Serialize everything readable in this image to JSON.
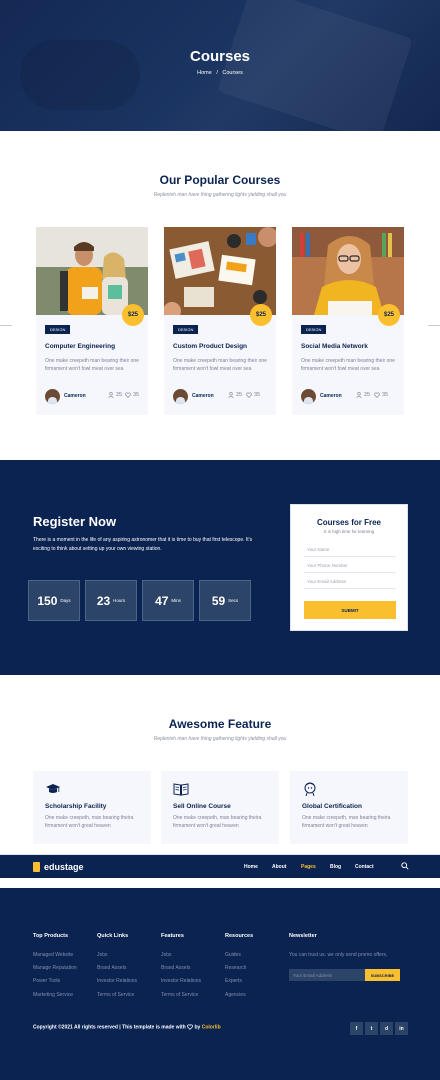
{
  "hero": {
    "title": "Courses",
    "breadcrumb_home": "Home",
    "breadcrumb_sep": "/",
    "breadcrumb_current": "Courses"
  },
  "popular": {
    "title": "Our Popular Courses",
    "subtitle": "Replenish man have thing gathering lights yielding shall you"
  },
  "courses": [
    {
      "price": "$25",
      "tag": "DESIGN",
      "title": "Computer Engineering",
      "description": "One make creepeth man bearing their one firmament won't fowl meat over sea",
      "author": "Cameron",
      "students": "25",
      "likes": "35"
    },
    {
      "price": "$25",
      "tag": "DESIGN",
      "title": "Custom Product Design",
      "description": "One make creepeth man bearing their one firmament won't fowl meat over sea",
      "author": "Cameron",
      "students": "25",
      "likes": "35"
    },
    {
      "price": "$25",
      "tag": "DESIGN",
      "title": "Social Media Network",
      "description": "One make creepeth man bearing their one firmament won't fowl meat over sea",
      "author": "Cameron",
      "students": "25",
      "likes": "35"
    }
  ],
  "register": {
    "title": "Register Now",
    "description": "There is a moment in the life of any aspiring astronomer that it is time to buy that first telescope. It's exciting to think about setting up your own viewing station.",
    "countdown": [
      {
        "value": "150",
        "unit": "Days"
      },
      {
        "value": "23",
        "unit": "Hours"
      },
      {
        "value": "47",
        "unit": "Mins"
      },
      {
        "value": "59",
        "unit": "Secs"
      }
    ],
    "form": {
      "title": "Courses for Free",
      "subtitle": "It is high time for learning",
      "name_placeholder": "Your Name",
      "phone_placeholder": "Your Phone Number",
      "email_placeholder": "Your Email Address",
      "submit": "SUBMIT"
    }
  },
  "features": {
    "title": "Awesome Feature",
    "subtitle": "Replenish man have thing gathering lights yielding shall you",
    "items": [
      {
        "icon": "graduation-cap-icon",
        "title": "Scholarship Facility",
        "description": "One make creepeth, man bearing theira firmament won't great heaven"
      },
      {
        "icon": "open-book-icon",
        "title": "Sell Online Course",
        "description": "One make creepeth, man bearing theira firmament won't great heaven"
      },
      {
        "icon": "certificate-icon",
        "title": "Global Certification",
        "description": "One make creepeth, man bearing theira firmament won't great heaven"
      }
    ]
  },
  "navbar": {
    "logo": "edustage",
    "items": [
      "Home",
      "About",
      "Pages",
      "Blog",
      "Contact"
    ],
    "active": "Pages"
  },
  "footer": {
    "columns": [
      {
        "title": "Top Products",
        "links": [
          "Managed Website",
          "Manage Reputation",
          "Power Tools",
          "Marketing Service"
        ]
      },
      {
        "title": "Quick Links",
        "links": [
          "Jobs",
          "Brand Assets",
          "Investor Relations",
          "Terms of Service"
        ]
      },
      {
        "title": "Features",
        "links": [
          "Jobs",
          "Brand Assets",
          "Investor Relations",
          "Terms of Service"
        ]
      },
      {
        "title": "Resources",
        "links": [
          "Guides",
          "Research",
          "Experts",
          "Agencies"
        ]
      }
    ],
    "newsletter": {
      "title": "Newsletter",
      "text": "You can trust us. we only send promo offers,",
      "placeholder": "Your Email Address",
      "button": "SUBSCRIBE"
    },
    "copyright_text": "Copyright ©2021 All rights reserved | This template is made with",
    "copyright_by": "by",
    "copyright_link": "Colorlib",
    "social": [
      "f",
      "t",
      "d",
      "in"
    ]
  },
  "colors": {
    "navy": "#0a2351",
    "accent": "#f9bf2f",
    "card_bg": "#f6f7fc"
  }
}
